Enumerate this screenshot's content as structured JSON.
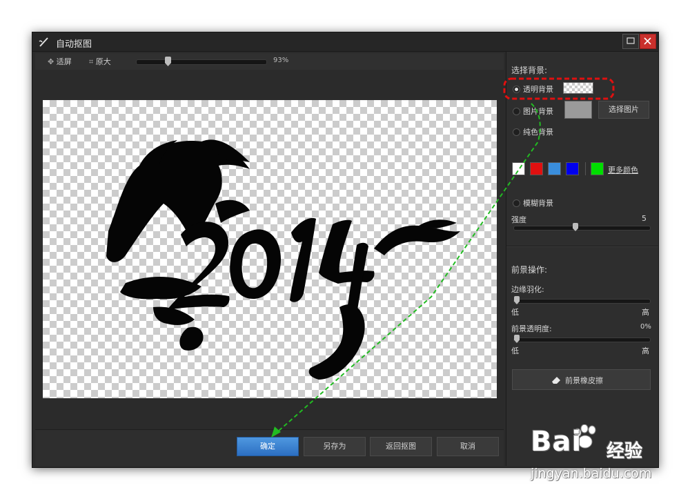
{
  "window": {
    "title": "自动抠图"
  },
  "toolbar": {
    "fit_label": "适屏",
    "original_label": "原大",
    "zoom_level": 0.23,
    "zoom_text": "93%"
  },
  "buttons": {
    "ok": "确定",
    "save_as": "另存为",
    "back": "返回抠图",
    "cancel": "取消"
  },
  "background": {
    "heading": "选择背景:",
    "transparent_label": "透明背景",
    "image_label": "图片背景",
    "select_image": "选择图片",
    "solid_label": "纯色背景",
    "more_colors": "更多颜色",
    "blur_label": "模糊背景",
    "strength_label": "强度",
    "strength_value": "5",
    "strength_level": 0.45,
    "selected": "transparent",
    "swatches": [
      "#ffffff",
      "#e01010",
      "#3a8edc",
      "#0000ee",
      "#00dd00"
    ]
  },
  "foreground": {
    "heading": "前景操作:",
    "feather_label": "边缘羽化:",
    "feather_low": "低",
    "feather_high": "高",
    "feather_level": 0.0,
    "opacity_label": "前景透明度:",
    "opacity_value": "0%",
    "opacity_low": "低",
    "opacity_high": "高",
    "opacity_level": 0.0,
    "eraser_label": "前景橡皮擦"
  },
  "canvas": {
    "artwork_text": "2014"
  },
  "watermark": {
    "brand": "Bai",
    "brand_suffix": "经验",
    "url": "jingyan.baidu.com"
  },
  "annotations": {
    "highlight_color": "#e01010",
    "arrow_color": "#22bb22"
  }
}
